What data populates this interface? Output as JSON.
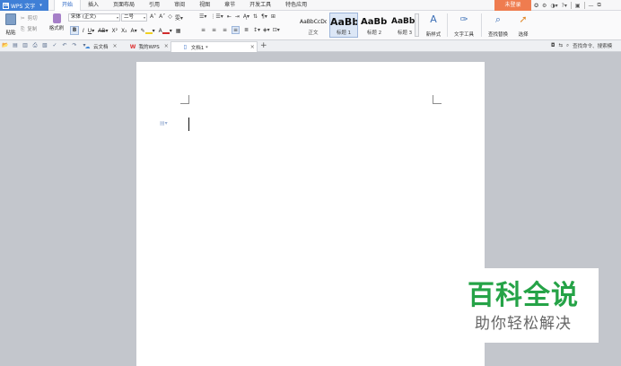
{
  "menubar": {
    "app_name": "WPS 文字",
    "tabs": [
      "开始",
      "插入",
      "页面布局",
      "引用",
      "审阅",
      "视图",
      "章节",
      "开发工具",
      "特色应用"
    ],
    "active_tab": "开始",
    "login_label": "未登录"
  },
  "ribbon": {
    "paste_label": "粘贴",
    "cut_label": "剪切",
    "copy_label": "复制",
    "format_painter_label": "格式刷",
    "font_name": "宋体 (正文)",
    "font_size": "二号",
    "styles": [
      {
        "sample": "AaBbCcDd",
        "name": "正文"
      },
      {
        "sample": "AaBb",
        "name": "标题 1"
      },
      {
        "sample": "AaBb(",
        "name": "标题 2"
      },
      {
        "sample": "AaBbC",
        "name": "标题 3"
      }
    ],
    "new_style_label": "新样式",
    "text_tools_label": "文字工具",
    "find_replace_label": "查找替换",
    "select_label": "选择"
  },
  "tabs": {
    "items": [
      {
        "label": "云文档"
      },
      {
        "label": "我的WPS"
      },
      {
        "label": "文档1 *"
      }
    ],
    "search_label": "查找命令、搜索模"
  },
  "watermark": {
    "title": "百科全说",
    "subtitle": "助你轻松解决"
  },
  "colors": {
    "app_blue": "#3f7fd6",
    "login_orange": "#ef7c4f",
    "watermark_green": "#25a347",
    "workspace": "#c3c6cc"
  }
}
